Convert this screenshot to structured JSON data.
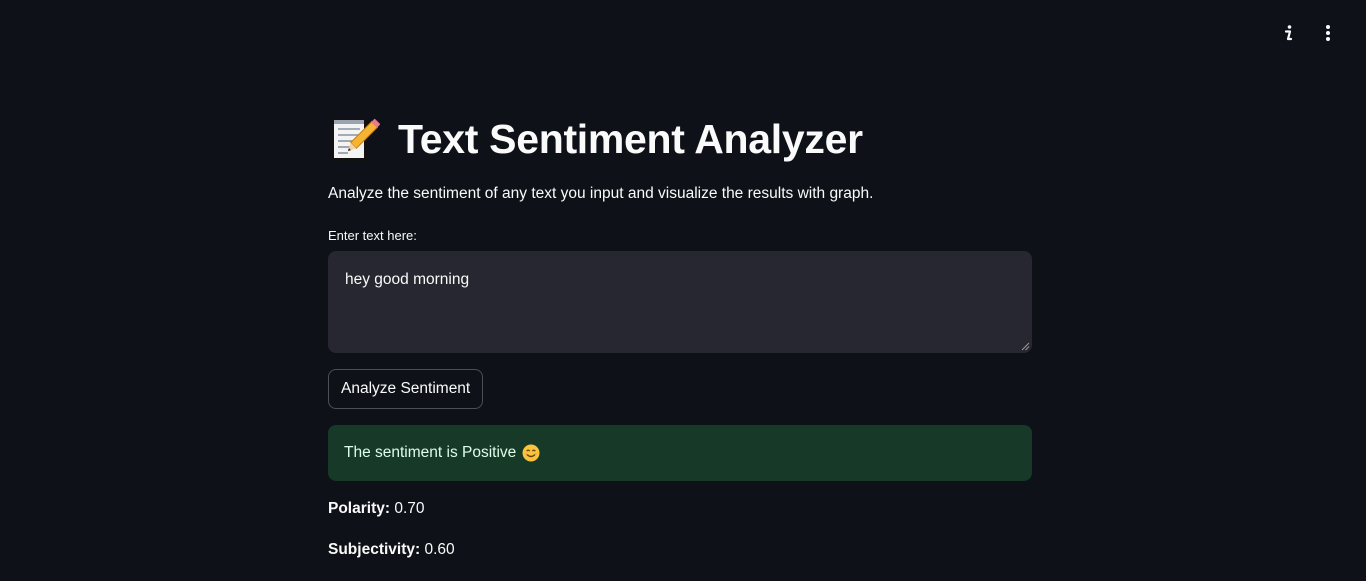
{
  "header": {
    "info_icon": "info-icon",
    "menu_icon": "more-vertical-icon"
  },
  "page": {
    "title_icon": "memo-pencil-icon",
    "title": "Text Sentiment Analyzer",
    "subtitle": "Analyze the sentiment of any text you input and visualize the results with graph."
  },
  "input": {
    "label": "Enter text here:",
    "value": "hey good morning"
  },
  "actions": {
    "analyze_label": "Analyze Sentiment"
  },
  "result": {
    "message": "The sentiment is Positive",
    "emoji_icon": "smiling-face-icon",
    "color": "#173928"
  },
  "metrics": {
    "polarity_label": "Polarity:",
    "polarity_value": "0.70",
    "subjectivity_label": "Subjectivity:",
    "subjectivity_value": "0.60"
  },
  "colors": {
    "background": "#0e1117",
    "input_bg": "#262730",
    "success_bg": "#173928",
    "text": "#fafafa"
  }
}
